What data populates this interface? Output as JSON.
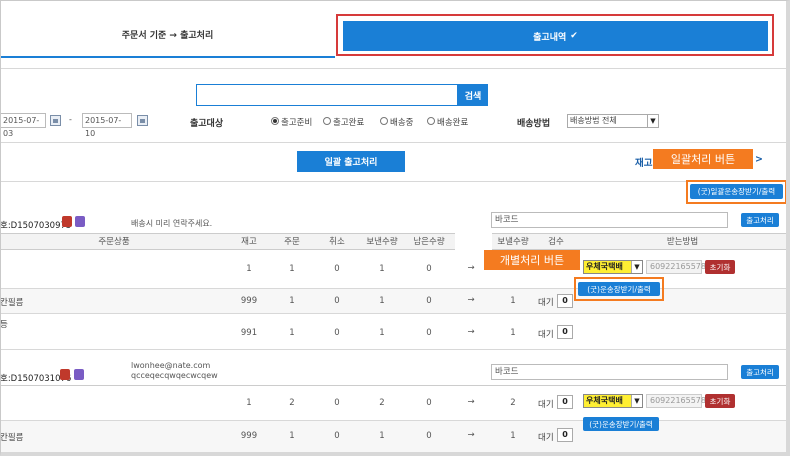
{
  "tabs": {
    "left": "주문서 기준 → 출고처리",
    "right": "출고내역"
  },
  "search": {
    "value": "",
    "button": "검색"
  },
  "date": {
    "from": "2015-07-03",
    "sep": "-",
    "to": "2015-07-10"
  },
  "filter_target": {
    "label": "출고대상",
    "options": [
      "출고준비",
      "출고완료",
      "배송중",
      "배송완료"
    ],
    "selected": 0
  },
  "ship_method": {
    "label": "배송방법",
    "value": "배송방법 전체"
  },
  "bulk_button": "일괄 출고처리",
  "right_link": "재고",
  "callouts": {
    "bulk": "일괄처리 버튼",
    "individual": "개별처리 버튼"
  },
  "bulk_print_button": "(굿)일괄운송장받기/출력",
  "colors": {
    "primary": "#1a7fd6",
    "callout": "#f47b20",
    "red": "#d63a3a",
    "carrier": "#ffef33"
  },
  "orders": [
    {
      "id": "호:D1507030975",
      "memo": "배송시 미리 연락주세요.",
      "memo2": "",
      "barcode": "바코드",
      "ship_button": "출고처리",
      "headers": {
        "product": "주문상품",
        "stock": "재고",
        "order": "주문",
        "cancel": "취소",
        "sent": "보낸수량",
        "remaining": "남은수량",
        "send_qty": "보낼수량",
        "inspect": "검수",
        "method": "받는방법"
      },
      "rows": [
        {
          "name": "",
          "stock": "1",
          "order": "1",
          "cancel": "0",
          "sent": "1",
          "remaining": "0",
          "arrow": "→",
          "send": "",
          "inspect": "",
          "qty": ""
        },
        {
          "name": "칸필름",
          "stock": "999",
          "order": "1",
          "cancel": "0",
          "sent": "1",
          "remaining": "0",
          "arrow": "→",
          "send": "1",
          "inspect": "대기",
          "qty": "0"
        },
        {
          "name": "등",
          "stock": "991",
          "order": "1",
          "cancel": "0",
          "sent": "1",
          "remaining": "0",
          "arrow": "→",
          "send": "1",
          "inspect": "대기",
          "qty": "0"
        }
      ],
      "carrier": "우체국택배",
      "tracking": "60922165578",
      "reset": "초기화",
      "print_button": "(굿)운송장받기/출력"
    },
    {
      "id": "호:D1507031076",
      "memo": "lwonhee@nate.com",
      "memo2": "qcceqecqwqecwcqew",
      "barcode": "바코드",
      "ship_button": "출고처리",
      "rows": [
        {
          "name": "",
          "stock": "1",
          "order": "2",
          "cancel": "0",
          "sent": "2",
          "remaining": "0",
          "arrow": "→",
          "send": "2",
          "inspect": "대기",
          "qty": "0"
        },
        {
          "name": "칸필름",
          "stock": "999",
          "order": "1",
          "cancel": "0",
          "sent": "1",
          "remaining": "0",
          "arrow": "→",
          "send": "1",
          "inspect": "대기",
          "qty": "0"
        }
      ],
      "carrier": "우체국택배",
      "tracking": "60922165578",
      "reset": "초기화",
      "print_button": "(굿)운송장받기/출력"
    }
  ]
}
